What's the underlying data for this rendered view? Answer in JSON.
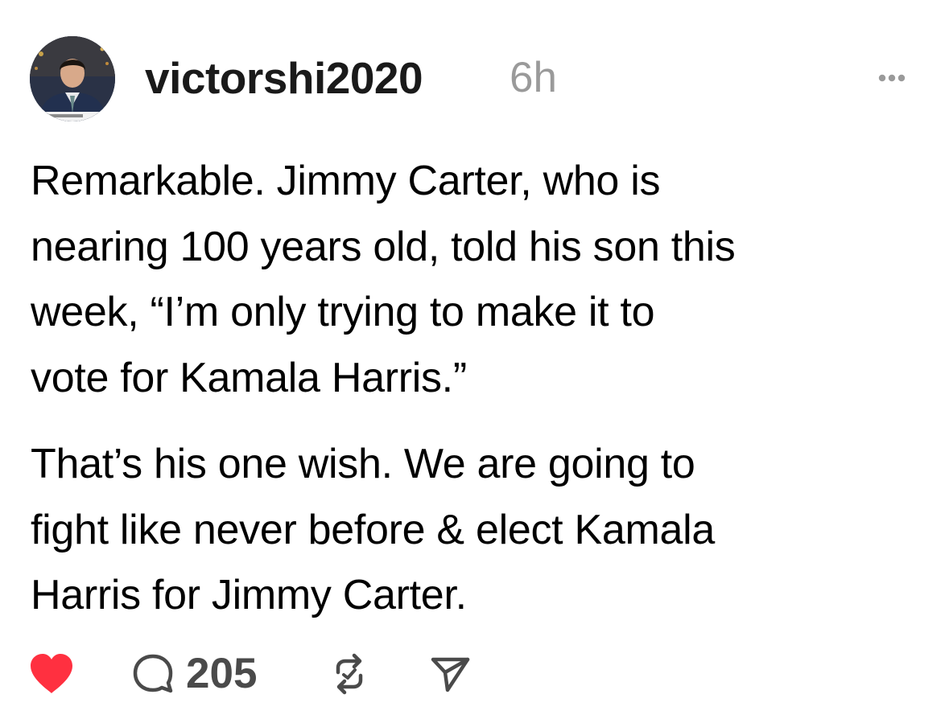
{
  "post": {
    "author": {
      "username": "victorshi2020",
      "avatar_icon": "avatar-photo"
    },
    "timestamp": "6h",
    "more_icon": "ellipsis-icon",
    "paragraph1": [
      "Remarkable. Jimmy Carter, who is",
      "nearing 100 years old, told his son this",
      "week, “I’m only trying to make it to",
      "vote for Kamala Harris.”"
    ],
    "paragraph2": [
      "That’s his one wish. We are going to",
      "fight like never before & elect Kamala",
      "Harris for Jimmy Carter."
    ],
    "actions": {
      "like_icon": "heart-icon",
      "like_color": "#ff3040",
      "reply_icon": "comment-icon",
      "reply_count": "205",
      "repost_icon": "repost-icon",
      "share_icon": "send-icon"
    }
  }
}
